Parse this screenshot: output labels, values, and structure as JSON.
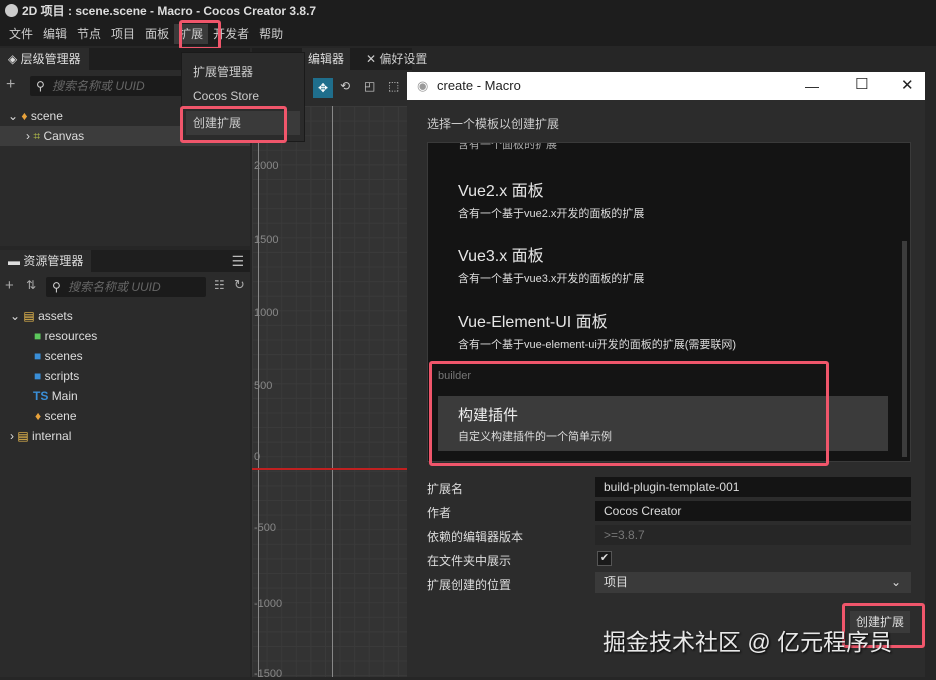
{
  "window": {
    "title": "2D 项目 : scene.scene - Macro - Cocos Creator 3.8.7"
  },
  "menu": [
    "文件",
    "编辑",
    "节点",
    "项目",
    "面板",
    "扩展",
    "开发者",
    "帮助"
  ],
  "ext_menu": [
    "扩展管理器",
    "Cocos Store",
    "创建扩展"
  ],
  "hierarchy": {
    "title": "层级管理器",
    "search_placeholder": "搜索名称或 UUID",
    "nodes": [
      "scene",
      "Canvas"
    ]
  },
  "assets": {
    "title": "资源管理器",
    "search_placeholder": "搜索名称或 UUID",
    "items": [
      "assets",
      "resources",
      "scenes",
      "scripts",
      "Main",
      "scene",
      "internal"
    ],
    "ts_badge": "TS"
  },
  "scene_tabs": [
    "编辑器",
    "偏好设置"
  ],
  "scene_ylabels": [
    "2000",
    "1500",
    "1000",
    "500",
    "0",
    "-500",
    "-1000",
    "-1500"
  ],
  "dialog": {
    "title": "create - Macro",
    "prompt": "选择一个模板以创建扩展",
    "clipped_desc": "含有一个面板的扩展",
    "templates": [
      {
        "name": "Vue2.x 面板",
        "desc": "含有一个基于vue2.x开发的面板的扩展"
      },
      {
        "name": "Vue3.x 面板",
        "desc": "含有一个基于vue3.x开发的面板的扩展"
      },
      {
        "name": "Vue-Element-UI 面板",
        "desc": "含有一个基于vue-element-ui开发的面板的扩展(需要联网)"
      }
    ],
    "group": "builder",
    "selected": {
      "name": "构建插件",
      "desc": "自定义构建插件的一个简单示例"
    },
    "form": {
      "name_label": "扩展名",
      "name_value": "build-plugin-template-001",
      "author_label": "作者",
      "author_value": "Cocos Creator",
      "version_label": "依赖的编辑器版本",
      "version_value": ">=3.8.7",
      "show_label": "在文件夹中展示",
      "show_checked": true,
      "location_label": "扩展创建的位置",
      "location_value": "项目"
    },
    "create_button": "创建扩展"
  },
  "watermark": "掘金技术社区 @ 亿元程序员",
  "colors": {
    "highlight": "#f0566b",
    "accent": "#1f6e8c"
  }
}
